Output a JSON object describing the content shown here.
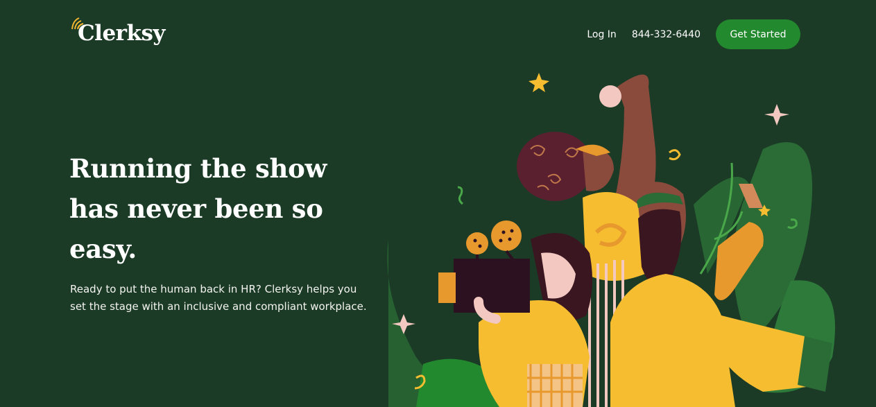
{
  "header": {
    "logo_text": "Clerksy",
    "login_label": "Log In",
    "phone": "844-332-6440",
    "cta_label": "Get Started"
  },
  "hero": {
    "title": "Running the show has never been so easy.",
    "subtitle": "Ready to put the human back in HR? Clerksy helps you set the stage with an inclusive and compliant workplace."
  },
  "colors": {
    "background": "#1b3b26",
    "accent": "#23892e",
    "yellow": "#f6bd30",
    "orange": "#e8992d"
  },
  "icons": [
    "logo-mark-icon",
    "star-icon",
    "sparkle-icon",
    "camera-icon",
    "megaphone-icon"
  ]
}
